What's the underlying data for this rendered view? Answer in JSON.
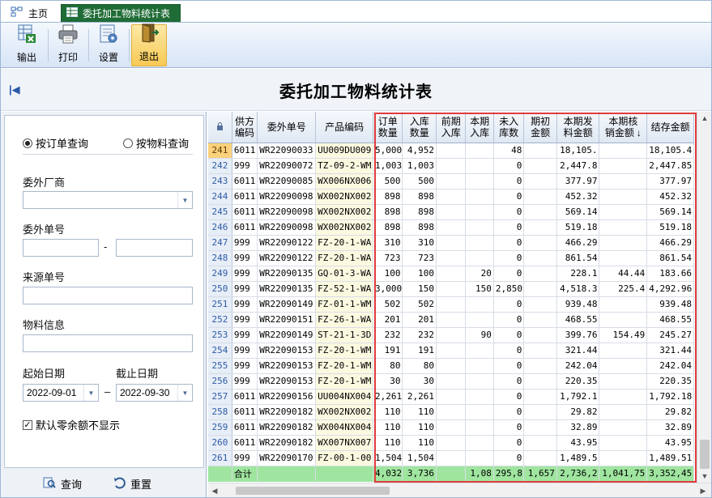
{
  "tabs": [
    {
      "label": "主页",
      "icon": "home-icon"
    },
    {
      "label": "委托加工物料统计表",
      "icon": "table-icon"
    }
  ],
  "toolbar": {
    "export_label": "输出",
    "print_label": "打印",
    "settings_label": "设置",
    "exit_label": "退出"
  },
  "page": {
    "title": "委托加工物料统计表",
    "collapse_glyph": "|◀"
  },
  "filters": {
    "radio_order": "按订单查询",
    "radio_material": "按物料查询",
    "vendor_label": "委外厂商",
    "vendor_value": "",
    "order_no_label": "委外单号",
    "order_from": "",
    "order_to": "",
    "dash": "-",
    "source_label": "来源单号",
    "source_value": "",
    "material_label": "物料信息",
    "material_value": "",
    "start_label": "起始日期",
    "end_label": "截止日期",
    "start_value": "2022-09-01",
    "end_value": "2022-09-30",
    "date_dash": "–",
    "hide_zero_label": "默认零余额不显示",
    "hide_zero_checked": true
  },
  "actions": {
    "query_label": "查询",
    "reset_label": "重置"
  },
  "grid": {
    "columns": [
      "",
      "供方\n编码",
      "委外单号",
      "产品编码",
      "订单\n数量",
      "入库\n数量",
      "前期\n入库",
      "本期\n入库",
      "未入\n库数",
      "期初\n金额",
      "本期发\n料金额",
      "本期核\n销金额",
      "结存金额"
    ],
    "sort_indicator": "↓",
    "rows": [
      [
        "241",
        "6011",
        "WR22090033",
        "UU009DU009",
        "5,000",
        "4,952",
        "",
        "",
        "48",
        "",
        "18,105.",
        "",
        "18,105.4"
      ],
      [
        "242",
        "999",
        "WR22090072",
        "TZ-09-2-WM",
        "1,003",
        "1,003",
        "",
        "",
        "0",
        "",
        "2,447.8",
        "",
        "2,447.85"
      ],
      [
        "243",
        "6011",
        "WR22090085",
        "WX006NX006",
        "500",
        "500",
        "",
        "",
        "0",
        "",
        "377.97",
        "",
        "377.97"
      ],
      [
        "244",
        "6011",
        "WR22090098",
        "WX002NX002",
        "898",
        "898",
        "",
        "",
        "0",
        "",
        "452.32",
        "",
        "452.32"
      ],
      [
        "245",
        "6011",
        "WR22090098",
        "WX002NX002",
        "898",
        "898",
        "",
        "",
        "0",
        "",
        "569.14",
        "",
        "569.14"
      ],
      [
        "246",
        "6011",
        "WR22090098",
        "WX002NX002",
        "898",
        "898",
        "",
        "",
        "0",
        "",
        "519.18",
        "",
        "519.18"
      ],
      [
        "247",
        "999",
        "WR22090122",
        "FZ-20-1-WA",
        "310",
        "310",
        "",
        "",
        "0",
        "",
        "466.29",
        "",
        "466.29"
      ],
      [
        "248",
        "999",
        "WR22090122",
        "FZ-20-1-WA",
        "723",
        "723",
        "",
        "",
        "0",
        "",
        "861.54",
        "",
        "861.54"
      ],
      [
        "249",
        "999",
        "WR22090135",
        "GQ-01-3-WA",
        "100",
        "100",
        "",
        "20",
        "0",
        "",
        "228.1",
        "44.44",
        "183.66"
      ],
      [
        "250",
        "999",
        "WR22090135",
        "FZ-52-1-WA",
        "3,000",
        "150",
        "",
        "150",
        "2,850",
        "",
        "4,518.3",
        "225.4",
        "4,292.96"
      ],
      [
        "251",
        "999",
        "WR22090149",
        "FZ-01-1-WM",
        "502",
        "502",
        "",
        "",
        "0",
        "",
        "939.48",
        "",
        "939.48"
      ],
      [
        "252",
        "999",
        "WR22090151",
        "FZ-26-1-WA",
        "201",
        "201",
        "",
        "",
        "0",
        "",
        "468.55",
        "",
        "468.55"
      ],
      [
        "253",
        "999",
        "WR22090149",
        "ST-21-1-3D",
        "232",
        "232",
        "",
        "90",
        "0",
        "",
        "399.76",
        "154.49",
        "245.27"
      ],
      [
        "254",
        "999",
        "WR22090153",
        "FZ-20-1-WM",
        "191",
        "191",
        "",
        "",
        "0",
        "",
        "321.44",
        "",
        "321.44"
      ],
      [
        "255",
        "999",
        "WR22090153",
        "FZ-20-1-WM",
        "80",
        "80",
        "",
        "",
        "0",
        "",
        "242.04",
        "",
        "242.04"
      ],
      [
        "256",
        "999",
        "WR22090153",
        "FZ-20-1-WM",
        "30",
        "30",
        "",
        "",
        "0",
        "",
        "220.35",
        "",
        "220.35"
      ],
      [
        "257",
        "6011",
        "WR22090156",
        "UU004NX004",
        "2,261",
        "2,261",
        "",
        "",
        "0",
        "",
        "1,792.1",
        "",
        "1,792.18"
      ],
      [
        "258",
        "6011",
        "WR22090182",
        "WX002NX002",
        "110",
        "110",
        "",
        "",
        "0",
        "",
        "29.82",
        "",
        "29.82"
      ],
      [
        "259",
        "6011",
        "WR22090182",
        "WX004NX004",
        "110",
        "110",
        "",
        "",
        "0",
        "",
        "32.89",
        "",
        "32.89"
      ],
      [
        "260",
        "6011",
        "WR22090182",
        "WX007NX007",
        "110",
        "110",
        "",
        "",
        "0",
        "",
        "43.95",
        "",
        "43.95"
      ],
      [
        "261",
        "999",
        "WR22090170",
        "FZ-00-1-00",
        "1,504",
        "1,504",
        "",
        "",
        "0",
        "",
        "1,489.5",
        "",
        "1,489.51"
      ]
    ],
    "total_label": "合计",
    "totals": [
      "4,032",
      "3,736",
      "",
      "1,08",
      "295,8",
      "1,657",
      "2,736,2",
      "1,041,75",
      "3,352,45"
    ]
  },
  "colors": {
    "accent": "#1f6c36",
    "highlight": "#e23c3c",
    "total_row": "#9fe59f",
    "current_row": "#fbd17c"
  }
}
